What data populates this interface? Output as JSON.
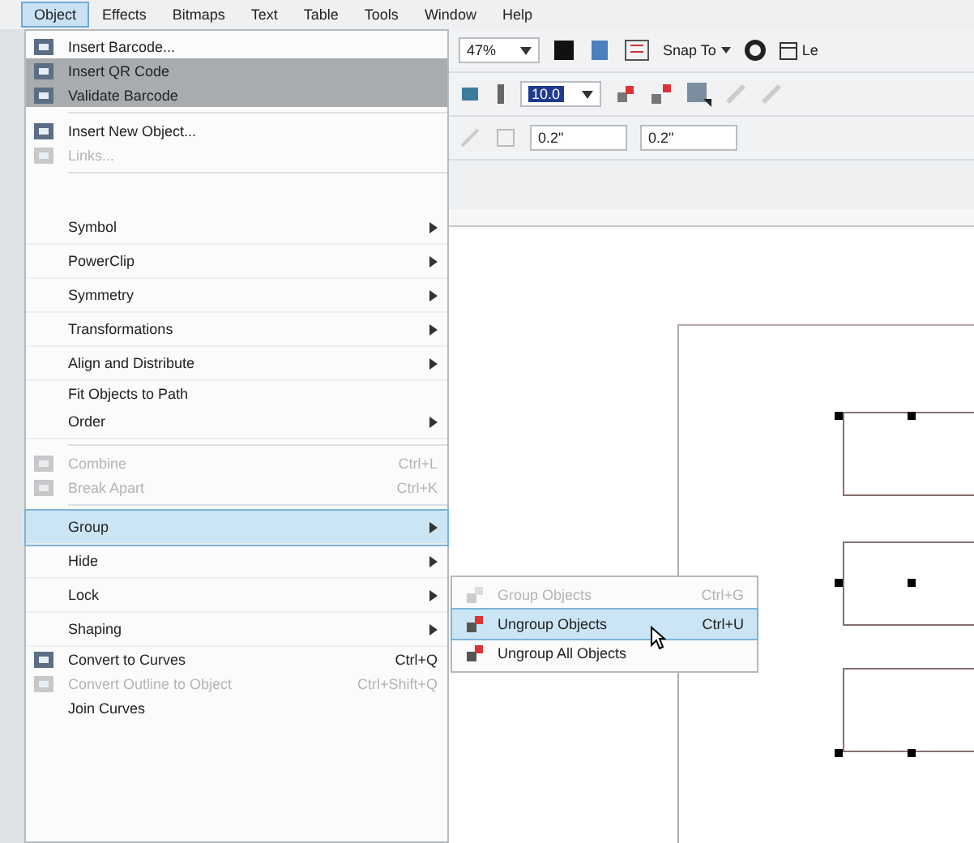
{
  "menubar": [
    {
      "label": "Object",
      "selected": true
    },
    {
      "label": "Effects",
      "selected": false
    },
    {
      "label": "Bitmaps",
      "selected": false
    },
    {
      "label": "Text",
      "selected": false
    },
    {
      "label": "Table",
      "selected": false
    },
    {
      "label": "Tools",
      "selected": false
    },
    {
      "label": "Window",
      "selected": false
    },
    {
      "label": "Help",
      "selected": false
    }
  ],
  "menu": [
    {
      "kind": "icon",
      "label": "Insert Barcode...",
      "submenu": false,
      "disabled": false,
      "selected": false,
      "shaded": false
    },
    {
      "kind": "icon",
      "label": "Insert QR Code",
      "submenu": false,
      "disabled": false,
      "selected": false,
      "shaded": true
    },
    {
      "kind": "icon",
      "label": "Validate Barcode",
      "submenu": false,
      "disabled": false,
      "selected": false,
      "shaded": true
    },
    {
      "kind": "separator"
    },
    {
      "kind": "icon",
      "label": "Insert New Object...",
      "submenu": false,
      "disabled": false,
      "selected": false,
      "shaded": false
    },
    {
      "kind": "icon",
      "label": "Links...",
      "submenu": false,
      "disabled": true,
      "selected": false,
      "shaded": false
    },
    {
      "kind": "separator"
    },
    {
      "kind": "gap"
    },
    {
      "kind": "item",
      "label": "Symbol",
      "submenu": true,
      "disabled": false,
      "selected": false,
      "shaded": false
    },
    {
      "kind": "item",
      "label": "PowerClip",
      "submenu": true,
      "disabled": false,
      "selected": false,
      "shaded": false
    },
    {
      "kind": "item",
      "label": "Symmetry",
      "submenu": true,
      "disabled": false,
      "selected": false,
      "shaded": false
    },
    {
      "kind": "item",
      "label": "Transformations",
      "submenu": true,
      "disabled": false,
      "selected": false,
      "shaded": false
    },
    {
      "kind": "item",
      "label": "Align and Distribute",
      "submenu": true,
      "disabled": false,
      "selected": false,
      "shaded": false
    },
    {
      "kind": "item",
      "label": "Fit Objects to Path",
      "submenu": false,
      "disabled": false,
      "selected": false,
      "shaded": false
    },
    {
      "kind": "item",
      "label": "Order",
      "submenu": true,
      "disabled": false,
      "selected": false,
      "shaded": false
    },
    {
      "kind": "separator"
    },
    {
      "kind": "icon",
      "label": "Combine",
      "shortcut": "Ctrl+L",
      "submenu": false,
      "disabled": true,
      "selected": false,
      "shaded": false
    },
    {
      "kind": "icon",
      "label": "Break Apart",
      "shortcut": "Ctrl+K",
      "submenu": false,
      "disabled": true,
      "selected": false,
      "shaded": false
    },
    {
      "kind": "separator"
    },
    {
      "kind": "item",
      "label": "Group",
      "submenu": true,
      "disabled": false,
      "selected": true,
      "shaded": false
    },
    {
      "kind": "item",
      "label": "Hide",
      "submenu": true,
      "disabled": false,
      "selected": false,
      "shaded": false
    },
    {
      "kind": "item",
      "label": "Lock",
      "submenu": true,
      "disabled": false,
      "selected": false,
      "shaded": false
    },
    {
      "kind": "item",
      "label": "Shaping",
      "submenu": true,
      "disabled": false,
      "selected": false,
      "shaded": false
    },
    {
      "kind": "icon",
      "label": "Convert to Curves",
      "shortcut": "Ctrl+Q",
      "submenu": false,
      "disabled": false,
      "selected": false,
      "shaded": false
    },
    {
      "kind": "icon",
      "label": "Convert Outline to Object",
      "shortcut": "Ctrl+Shift+Q",
      "submenu": false,
      "disabled": true,
      "selected": false,
      "shaded": false
    },
    {
      "kind": "item",
      "label": "Join Curves",
      "submenu": false,
      "disabled": false,
      "selected": false,
      "shaded": false
    }
  ],
  "submenu": [
    {
      "label": "Group Objects",
      "shortcut": "Ctrl+G",
      "disabled": true,
      "selected": false
    },
    {
      "label": "Ungroup Objects",
      "shortcut": "Ctrl+U",
      "disabled": false,
      "selected": true
    },
    {
      "label": "Ungroup All Objects",
      "disabled": false,
      "selected": false
    }
  ],
  "toolbar": {
    "zoom": "47%",
    "snap": "Snap To",
    "cut_label": "Le",
    "size_value": "10.0",
    "width_field": "0.2\"",
    "height_field": "0.2\""
  }
}
